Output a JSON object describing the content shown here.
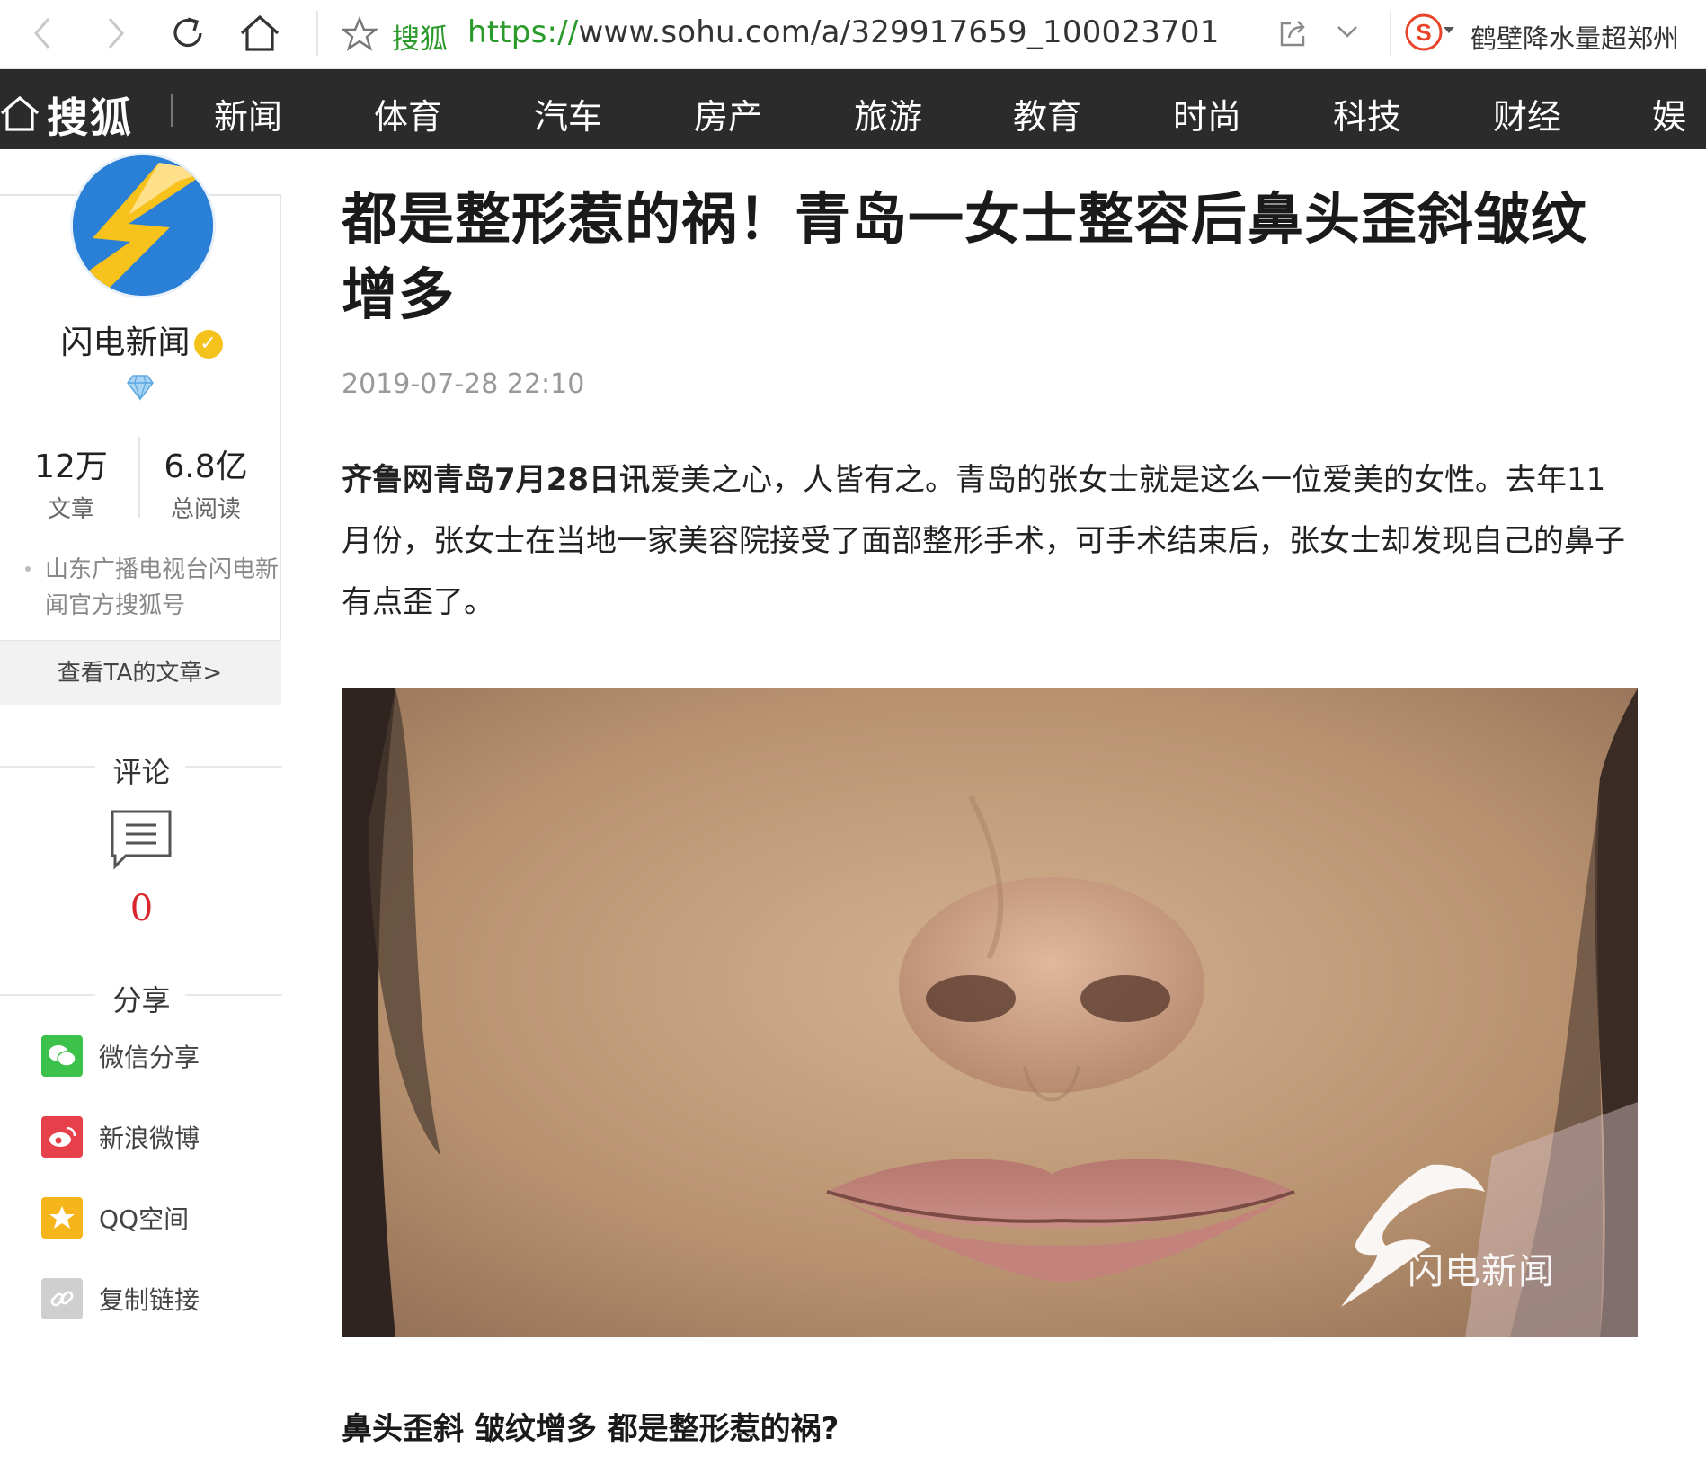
{
  "browser": {
    "site_name": "搜狐",
    "url_protocol": "https://",
    "url_rest": "www.sohu.com/a/329917659_100023701",
    "search_text": "鹤壁降水量超郑州"
  },
  "site_nav": {
    "logo_text": "搜狐",
    "items": [
      "新闻",
      "体育",
      "汽车",
      "房产",
      "旅游",
      "教育",
      "时尚",
      "科技",
      "财经",
      "娱乐"
    ]
  },
  "author": {
    "name": "闪电新闻",
    "articles_count": "12万",
    "articles_label": "文章",
    "reads_count": "6.8亿",
    "reads_label": "总阅读",
    "description": "山东广播电视台闪电新闻官方搜狐号",
    "view_articles_label": "查看TA的文章>"
  },
  "comments": {
    "title": "评论",
    "count": "0"
  },
  "share": {
    "title": "分享",
    "items": [
      {
        "label": "微信分享",
        "icon": "wechat-icon",
        "color": "#3cc24a"
      },
      {
        "label": "新浪微博",
        "icon": "weibo-icon",
        "color": "#e6404a"
      },
      {
        "label": "QQ空间",
        "icon": "qzone-icon",
        "color": "#f5b51b"
      },
      {
        "label": "复制链接",
        "icon": "link-icon",
        "color": "#cfcfcf"
      }
    ]
  },
  "article": {
    "title": "都是整形惹的祸！青岛一女士整容后鼻头歪斜皱纹增多",
    "date": "2019-07-28 22:10",
    "lead_source": "齐鲁网青岛7月28日讯",
    "lead_text": "爱美之心，人皆有之。青岛的张女士就是这么一位爱美的女性。去年11月份，张女士在当地一家美容院接受了面部整形手术，可手术结束后，张女士却发现自己的鼻子有点歪了。",
    "photo_watermark": "闪电新闻",
    "subheading": "鼻头歪斜 皱纹增多 都是整形惹的祸?"
  },
  "colors": {
    "nav_bg": "#2b2b2b",
    "url_green": "#2a9a2a",
    "comment_red": "#d9262c"
  }
}
